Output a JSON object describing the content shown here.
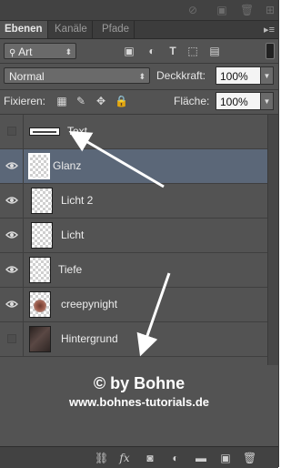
{
  "tabs": [
    {
      "label": "Ebenen",
      "active": true
    },
    {
      "label": "Kanäle",
      "active": false
    },
    {
      "label": "Pfade",
      "active": false
    }
  ],
  "filter": {
    "kind": "Art"
  },
  "blend": {
    "mode": "Normal",
    "opacity_label": "Deckkraft:",
    "opacity": "100%"
  },
  "lock": {
    "label": "Fixieren:",
    "fill_label": "Fläche:",
    "fill": "100%"
  },
  "layers": [
    {
      "name": "Text",
      "visible": false,
      "selected": false,
      "thumb": "text"
    },
    {
      "name": "Glanz",
      "visible": true,
      "selected": true,
      "thumb": "transparent"
    },
    {
      "name": "Licht 2",
      "visible": true,
      "selected": false,
      "thumb": "transparent"
    },
    {
      "name": "Licht",
      "visible": true,
      "selected": false,
      "thumb": "transparent"
    },
    {
      "name": "Tiefe",
      "visible": true,
      "selected": false,
      "thumb": "transparent"
    },
    {
      "name": "creepynight",
      "visible": true,
      "selected": false,
      "thumb": "photo"
    },
    {
      "name": "Hintergrund",
      "visible": false,
      "selected": false,
      "thumb": "dark"
    }
  ],
  "watermark": {
    "line1": "© by Bohne",
    "line2": "www.bohnes-tutorials.de"
  },
  "colors": {
    "panel": "#535353",
    "selected_row": "#5b6778",
    "arrow": "#ffffff"
  }
}
